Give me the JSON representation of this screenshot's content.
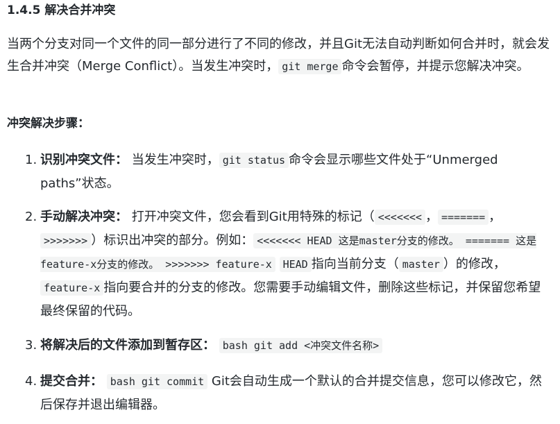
{
  "section": {
    "heading": "1.4.5 解决合并冲突"
  },
  "intro": {
    "t1": "当两个分支对同一个文件的同一部分进行了不同的修改，并且Git无法自动判断如何合并时，就会发生合并冲突（Merge Conflict）。当发生冲突时，",
    "code1": "git merge",
    "t2": "命令会暂停，并提示您解决冲突。"
  },
  "steps_title": "冲突解决步骤：",
  "steps": [
    {
      "num": "1.",
      "label": "识别冲突文件：",
      "t1": " 当发生冲突时，",
      "code1": "git status",
      "t2": "命令会显示哪些文件处于“Unmerged paths”状态。"
    },
    {
      "num": "2.",
      "label": "手动解决冲突：",
      "t1": " 打开冲突文件，您会看到Git用特殊的标记（",
      "code1": "<<<<<<<",
      "t2": "，",
      "code2": "=======",
      "t3": "，",
      "code3": ">>>>>>>",
      "t4": "）标识出冲突的部分。例如：",
      "code4": "<<<<<<< HEAD 这是master分支的修改。 ======= 这是feature-x分支的修改。 >>>>>>> feature-x",
      "t5": " ",
      "code5": "HEAD",
      "t6": "指向当前分支（",
      "code6": "master",
      "t7": "）的修改，",
      "code7": "feature-x",
      "t8": "指向要合并的分支的修改。您需要手动编辑文件，删除这些标记，并保留您希望最终保留的代码。"
    },
    {
      "num": "3.",
      "label": "将解决后的文件添加到暂存区：",
      "t1": " ",
      "code1": "bash git add <冲突文件名称>"
    },
    {
      "num": "4.",
      "label": "提交合并：",
      "t1": " ",
      "code1": "bash git commit",
      "t2": " Git会自动生成一个默认的合并提交信息，您可以修改它，然后保存并退出编辑器。"
    }
  ]
}
